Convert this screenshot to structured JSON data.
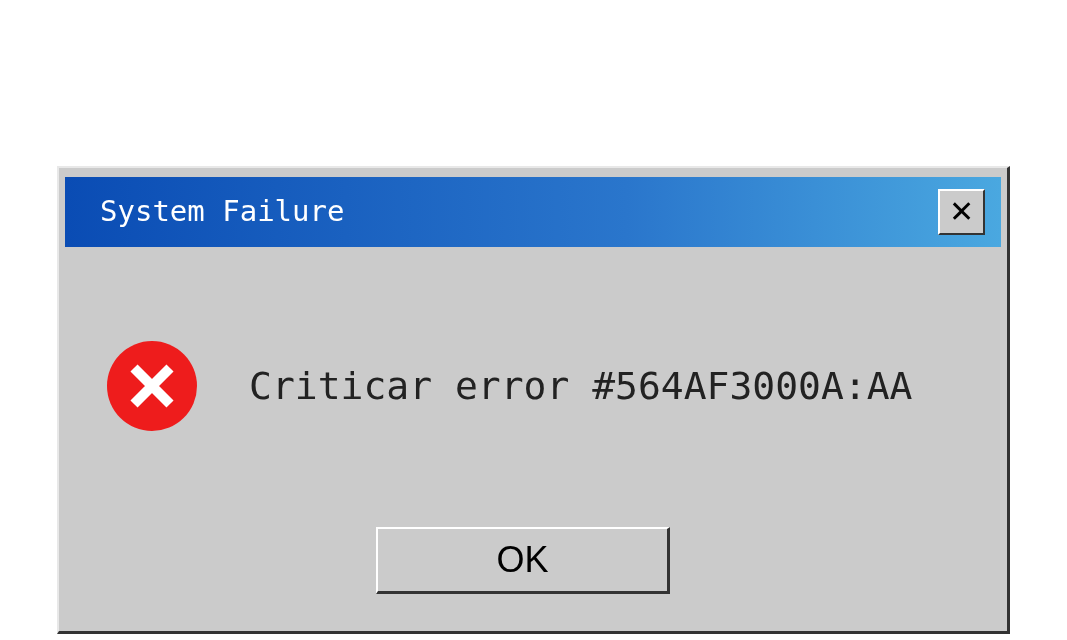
{
  "window": {
    "title": "System Failure",
    "close_label": "✕"
  },
  "message": {
    "kind": "error",
    "text": "Criticar error #564AF3000A:AA"
  },
  "buttons": [
    "OK"
  ]
}
